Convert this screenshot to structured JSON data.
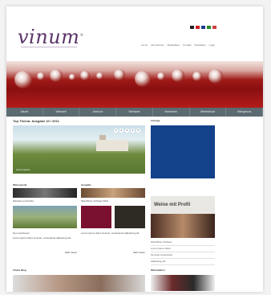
{
  "header": {
    "logo_text": "vinum",
    "logo_mark": "®",
    "flags": [
      {
        "name": "flag-de",
        "color": "#222222"
      },
      {
        "name": "flag-ch",
        "color": "#d02020"
      },
      {
        "name": "flag-fr",
        "color": "#1c3c8c"
      },
      {
        "name": "flag-it",
        "color": "#2a8c2a"
      },
      {
        "name": "flag-other",
        "color": "#d04040"
      }
    ],
    "topnav": [
      "Home",
      "Abo-Service",
      "Mediadaten",
      "Kontakt",
      "Newsletter",
      "Login"
    ]
  },
  "mainnav": [
    "Aktuell",
    "Weinwelt",
    "Jahrbuch",
    "Weinkarte",
    "Weinreisen",
    "Weinfeinkost",
    "Weingenuss"
  ],
  "content": {
    "section_title": "Top Thema: Ausgabe 10 / 2011",
    "hero_caption": "Lorem ipsum",
    "hero_dots": [
      "1",
      "2",
      "3",
      "4",
      "5"
    ],
    "left_thumbs": [
      {
        "title": "Weinspecial",
        "caption": "Weinfest und Kultur",
        "text": "Lorem ipsum dolor sit amet, consectetur adipiscing elit."
      },
      {
        "title": "Blind Tasting",
        "caption": "Neu erschienen",
        "text": "Lorem ipsum dolor sit amet, consectetur."
      }
    ],
    "right_thumbs": [
      {
        "title": "Ausgabe",
        "caption": "Weinführer Schweiz 2012",
        "text": "Lorem ipsum dolor sit amet, consectetur adipiscing elit."
      }
    ],
    "more_label": "Mehr lesen",
    "bottom_title": "Vinum Blog"
  },
  "right": {
    "title_top": "Anzeige",
    "ad_title": "Weine mit Profil",
    "ad_subtitle": "Anzeige",
    "list": [
      "Weinführer Schweiz",
      "Lorem ipsum dolor",
      "Sit amet consectetur",
      "Adipiscing elit"
    ],
    "bottom_title": "Weinauktion"
  }
}
